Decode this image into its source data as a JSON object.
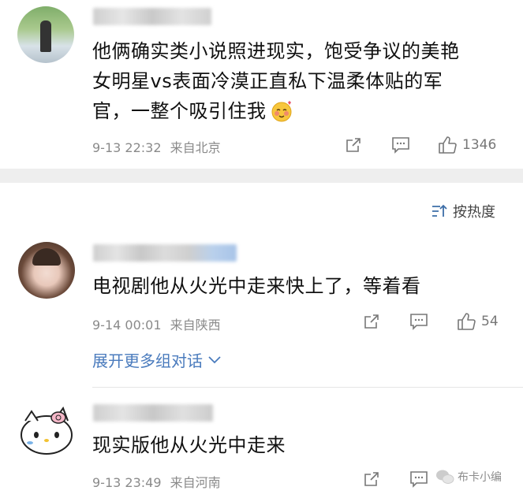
{
  "comments": [
    {
      "text_lines": [
        "他俩确实类小说照进现实，饱受争议的美艳",
        "女明星vs表面冷漠正直私下温柔体贴的军",
        "官，一整个吸引住我"
      ],
      "date": "9-13 22:32",
      "location": "来自北京",
      "like_count": "1346"
    },
    {
      "text_lines": [
        "电视剧他从火光中走来快上了，等着看"
      ],
      "date": "9-14 00:01",
      "location": "来自陕西",
      "like_count": "54"
    },
    {
      "text_lines": [
        "现实版他从火光中走来"
      ],
      "date": "9-13 23:49",
      "location": "来自河南",
      "like_count": ""
    }
  ],
  "sort_label": "按热度",
  "expand_label": "展开更多组对话",
  "watermark": "布卡小编",
  "icons": {
    "share": "share-icon",
    "comment": "comment-icon",
    "like": "like-icon",
    "sort": "sort-icon",
    "chevron": "chevron-down-icon",
    "emoji": "blushing-emoji-icon"
  },
  "colors": {
    "link": "#4a7bbd",
    "meta": "#8a8a8a",
    "band": "#eeeeee"
  }
}
